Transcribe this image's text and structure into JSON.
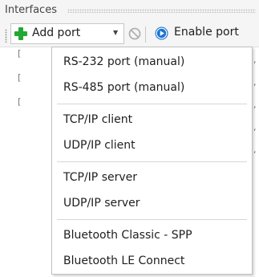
{
  "panel": {
    "title": "Interfaces"
  },
  "toolbar": {
    "add_port_label": "Add port",
    "enable_port_label": "Enable port",
    "icons": [
      "grip-icon",
      "plus-icon",
      "dropdown-arrow-icon",
      "disabled-stop-icon",
      "play-icon"
    ],
    "colors": {
      "plus": "#22a834",
      "play": "#1a73d2",
      "stop": "#b0b0b0"
    }
  },
  "list_peek": {
    "left_marker": "[",
    "right_marker": ","
  },
  "menu": {
    "groups": [
      [
        "RS-232 port (manual)",
        "RS-485 port (manual)"
      ],
      [
        "TCP/IP client",
        "UDP/IP client"
      ],
      [
        "TCP/IP server",
        "UDP/IP server"
      ],
      [
        "Bluetooth Classic - SPP",
        "Bluetooth LE Connect"
      ]
    ]
  }
}
